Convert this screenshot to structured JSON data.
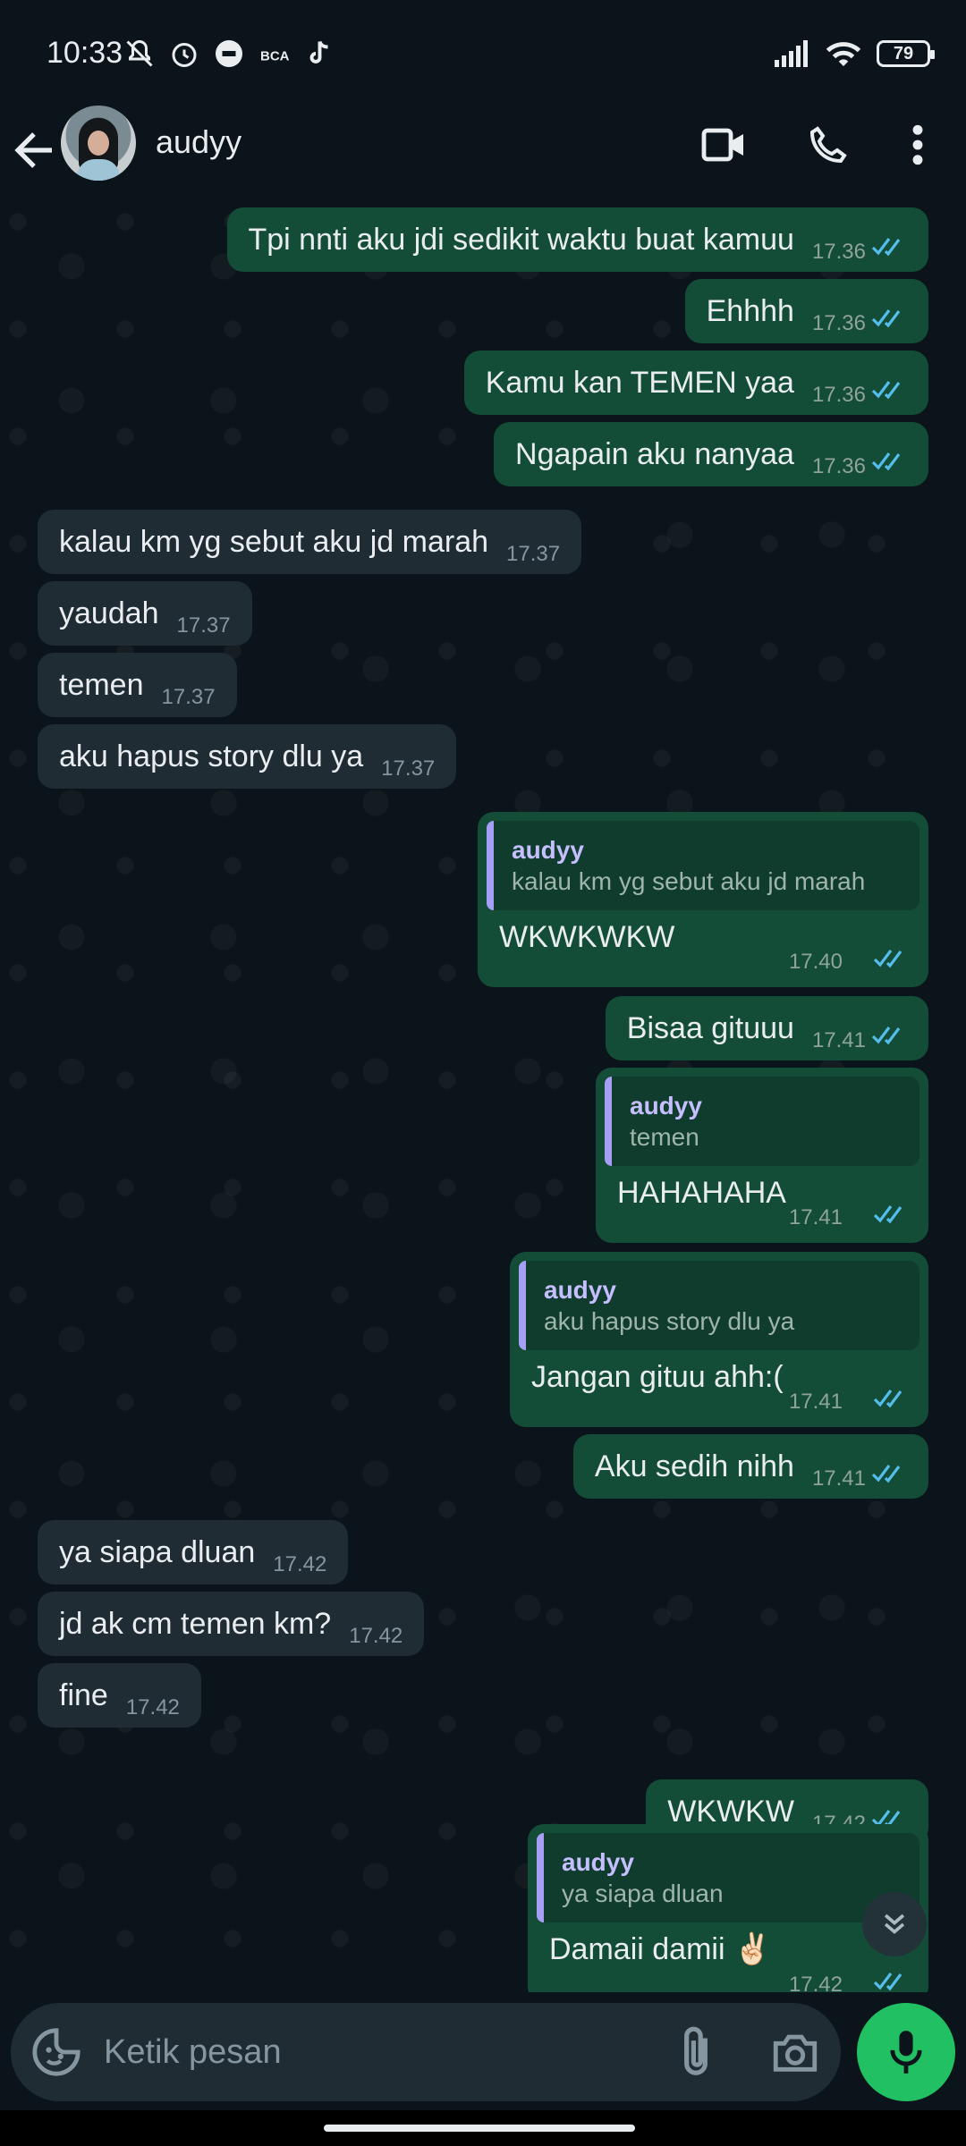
{
  "status_bar": {
    "time": "10:33",
    "battery": "79"
  },
  "header": {
    "contact_name": "audyy"
  },
  "messages": [
    {
      "dir": "out",
      "text": "Tpi nnti aku jdi sedikit waktu buat kamuu",
      "time": "17.36"
    },
    {
      "dir": "out",
      "text": "Ehhhh",
      "time": "17.36"
    },
    {
      "dir": "out",
      "text": "Kamu kan TEMEN yaa",
      "time": "17.36"
    },
    {
      "dir": "out",
      "text": "Ngapain aku nanyaa",
      "time": "17.36"
    },
    {
      "dir": "in",
      "text": "kalau km yg sebut aku jd marah",
      "time": "17.37"
    },
    {
      "dir": "in",
      "text": "yaudah",
      "time": "17.37"
    },
    {
      "dir": "in",
      "text": "temen",
      "time": "17.37"
    },
    {
      "dir": "in",
      "text": "aku hapus story dlu ya",
      "time": "17.37"
    },
    {
      "dir": "out",
      "quote_name": "audyy",
      "quote_text": "kalau km yg sebut aku jd marah",
      "text": "WKWKWKW",
      "time": "17.40"
    },
    {
      "dir": "out",
      "text": "Bisaa gituuu",
      "time": "17.41"
    },
    {
      "dir": "out",
      "quote_name": "audyy",
      "quote_text": "temen",
      "text": "HAHAHAHA",
      "time": "17.41"
    },
    {
      "dir": "out",
      "quote_name": "audyy",
      "quote_text": "aku hapus story dlu ya",
      "text": "Jangan gituu ahh:(",
      "time": "17.41"
    },
    {
      "dir": "out",
      "text": "Aku sedih nihh",
      "time": "17.41"
    },
    {
      "dir": "in",
      "text": "ya siapa dluan",
      "time": "17.42"
    },
    {
      "dir": "in",
      "text": "jd ak cm temen km?",
      "time": "17.42"
    },
    {
      "dir": "in",
      "text": "fine",
      "time": "17.42"
    },
    {
      "dir": "out",
      "text": "WKWKW",
      "time": "17.42"
    },
    {
      "dir": "out",
      "quote_name": "audyy",
      "quote_text": "ya siapa dluan",
      "text": "Damaii damii ✌🏻",
      "time": "17.42"
    }
  ],
  "input": {
    "placeholder": "Ketik pesan"
  },
  "colors": {
    "outgoing_bubble": "#144d37",
    "incoming_bubble": "#1f2c34",
    "read_tick": "#53bdeb",
    "mic_button": "#21c063"
  },
  "icons": [
    "back-arrow-icon",
    "video-call-icon",
    "phone-icon",
    "more-vert-icon",
    "emoji-icon",
    "attach-icon",
    "camera-icon",
    "mic-icon",
    "chevrons-down-icon"
  ]
}
